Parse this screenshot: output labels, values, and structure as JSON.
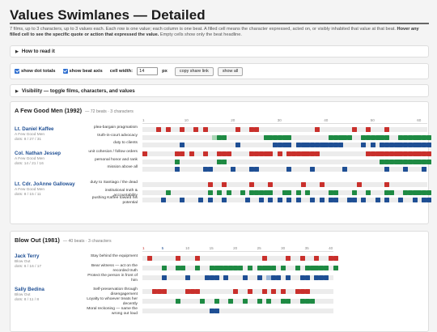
{
  "title": "Values Swimlanes — Detailed",
  "intro": {
    "line1": "7 films, up to 3 characters, up to 3 values each. Each row is one value; each column is one beat. A filled cell means the character expressed, acted on, or visibly inhabited that value at that beat.",
    "line2_bold": "Hover any filled cell to see the specific quote or action that expressed the value.",
    "line2_rest": " Empty cells show only the beat headline."
  },
  "how_to_read": "How to read it",
  "controls": {
    "show_dot_totals": "show dot totals",
    "show_beat_axis": "show beat axis",
    "cell_width_label": "cell width:",
    "cell_width_value": "14",
    "cell_width_unit": "px",
    "copy_share_link": "copy share link",
    "show_all": "show all"
  },
  "visibility": "Visibility — toggle films, characters, and values",
  "colors": {
    "red": "#c9302c",
    "green": "#1e8a43",
    "blue": "#1f4f94"
  },
  "films": [
    {
      "title": "A Few Good Men (1992)",
      "meta": "— 72 beats · 3 characters",
      "axis_ticks": [
        "1",
        "10",
        "20",
        "30",
        "40",
        "50",
        "60"
      ],
      "characters": [
        {
          "name": "Lt. Daniel Kaffee",
          "film": "A Few Good Men",
          "dots": "dots: 8 / 27 / 31",
          "values": [
            "plea-bargain pragmatism",
            "truth-in-court advocacy",
            "duty to clients"
          ]
        },
        {
          "name": "Col. Nathan Jessep",
          "film": "A Few Good Men",
          "dots": "dots: 14 / 21 / 16",
          "values": [
            "unit cohesion / follow orders",
            "personal honor and rank",
            "mission above all"
          ]
        },
        {
          "name": "Lt. Cdr. JoAnne Galloway",
          "film": "A Few Good Men",
          "dots": "dots: 8 / 15 / 11",
          "values": [
            "duty to Santiago / the dead",
            "institutional truth & accountability",
            "pushing Kaffee toward his potential"
          ]
        }
      ]
    },
    {
      "title": "Blow Out (1981)",
      "meta": "— 40 beats · 3 characters",
      "axis_ticks": [
        "1",
        "5",
        "10",
        "15",
        "20",
        "25",
        "30",
        "35",
        "40"
      ],
      "characters": [
        {
          "name": "Jack Terry",
          "film": "Blow Out",
          "dots": "dots: 6 / 16 / 17",
          "values": [
            "Stay behind the equipment",
            "Bear witness — act on the recorded truth",
            "Protect the person in front of him"
          ]
        },
        {
          "name": "Sally Bedina",
          "film": "Blow Out",
          "dots": "dots: 8 / 11 / 8",
          "values": [
            "Self-preservation through disengagement",
            "Loyalty to whoever treats her decently",
            "Moral reckoning — name the wrong out loud"
          ]
        }
      ]
    }
  ]
}
